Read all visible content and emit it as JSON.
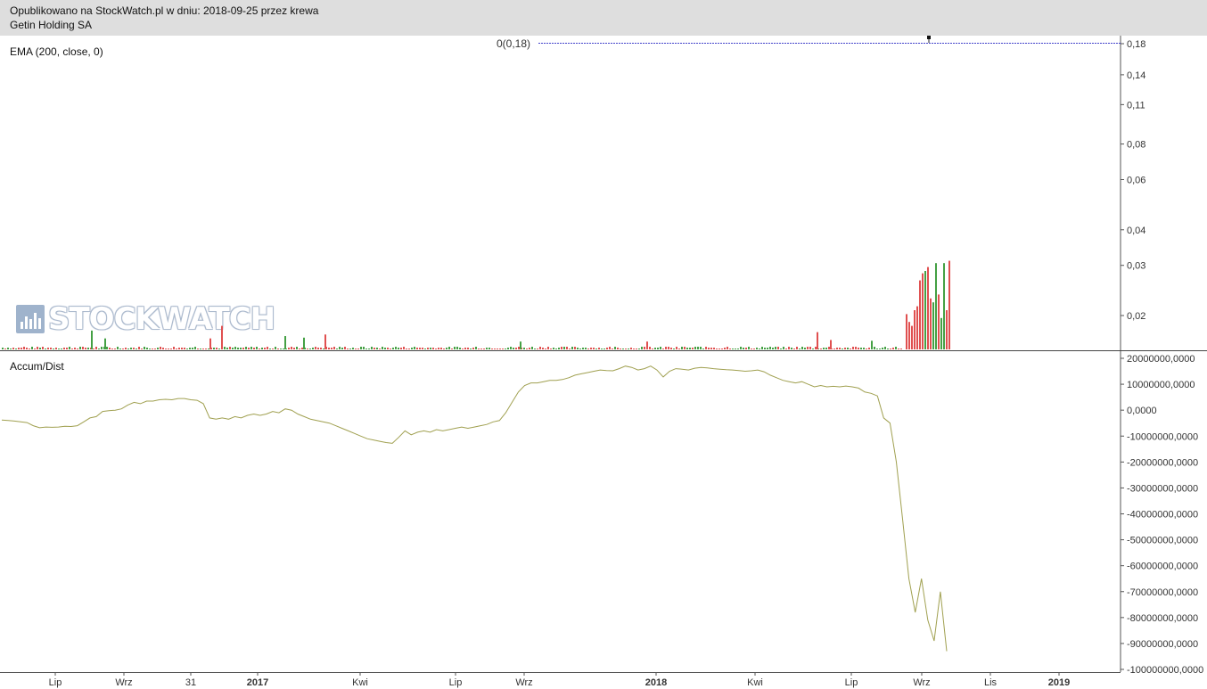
{
  "header": {
    "published": "Opublikowano na StockWatch.pl w dniu: 2018-09-25 przez krewa",
    "instrument": "Getin Holding SA"
  },
  "watermark": {
    "text": "STOCKWATCH",
    "icon": "bar-chart-logo-icon"
  },
  "price_panel": {
    "label": "EMA (200, close, 0)",
    "ema_marker_label": "0(0,18)",
    "ema_line_color": "#4444cc",
    "volume_up_color": "#44a044",
    "volume_down_color": "#e05050"
  },
  "accum_panel": {
    "label": "Accum/Dist",
    "line_color": "#a0a050"
  },
  "chart_data": [
    {
      "type": "bar",
      "title": "EMA (200, close, 0)",
      "scale": "log",
      "y_ticks": [
        "0,18",
        "0,14",
        "0,11",
        "0,08",
        "0,06",
        "0,04",
        "0,03",
        "0,02"
      ],
      "y_tick_values": [
        0.18,
        0.14,
        0.11,
        0.08,
        0.06,
        0.04,
        0.03,
        0.02
      ],
      "ylim": [
        0.0155,
        0.185
      ],
      "ema_value": 0.18,
      "volume_bars": [
        {
          "x": 102,
          "v": 0.24,
          "up": true
        },
        {
          "x": 117,
          "v": 0.14,
          "up": true
        },
        {
          "x": 248,
          "v": 0.3,
          "up": false
        },
        {
          "x": 235,
          "v": 0.14,
          "up": false
        },
        {
          "x": 319,
          "v": 0.17,
          "up": true
        },
        {
          "x": 340,
          "v": 0.15,
          "up": true
        },
        {
          "x": 364,
          "v": 0.19,
          "up": false
        },
        {
          "x": 583,
          "v": 0.1,
          "up": true
        },
        {
          "x": 725,
          "v": 0.1,
          "up": false
        },
        {
          "x": 916,
          "v": 0.22,
          "up": false
        },
        {
          "x": 931,
          "v": 0.12,
          "up": false
        },
        {
          "x": 977,
          "v": 0.11,
          "up": true
        },
        {
          "x": 1016,
          "v": 0.45,
          "up": false
        },
        {
          "x": 1019,
          "v": 0.35,
          "up": false
        },
        {
          "x": 1022,
          "v": 0.3,
          "up": false
        },
        {
          "x": 1025,
          "v": 0.5,
          "up": false
        },
        {
          "x": 1028,
          "v": 0.55,
          "up": false
        },
        {
          "x": 1031,
          "v": 0.88,
          "up": false
        },
        {
          "x": 1034,
          "v": 0.97,
          "up": false
        },
        {
          "x": 1037,
          "v": 1.0,
          "up": true
        },
        {
          "x": 1040,
          "v": 1.05,
          "up": false
        },
        {
          "x": 1043,
          "v": 0.65,
          "up": false
        },
        {
          "x": 1046,
          "v": 0.6,
          "up": true
        },
        {
          "x": 1049,
          "v": 1.1,
          "up": true
        },
        {
          "x": 1052,
          "v": 0.7,
          "up": false
        },
        {
          "x": 1055,
          "v": 0.4,
          "up": true
        },
        {
          "x": 1058,
          "v": 1.1,
          "up": true
        },
        {
          "x": 1061,
          "v": 0.5,
          "up": false
        },
        {
          "x": 1064,
          "v": 1.13,
          "up": false
        }
      ]
    },
    {
      "type": "line",
      "title": "Accum/Dist",
      "y_ticks": [
        "20000000,0000",
        "10000000,0000",
        "0,0000",
        "-10000000,0000",
        "-20000000,0000",
        "-30000000,0000",
        "-40000000,0000",
        "-50000000,0000",
        "-60000000,0000",
        "-70000000,0000",
        "-80000000,0000",
        "-90000000,0000",
        "-100000000,0000"
      ],
      "y_tick_values": [
        20000000,
        10000000,
        0,
        -10000000,
        -20000000,
        -30000000,
        -40000000,
        -50000000,
        -60000000,
        -70000000,
        -80000000,
        -90000000,
        -100000000
      ],
      "ylim": [
        -100000000,
        22000000
      ],
      "x_ticks": [
        {
          "label": "Lip",
          "bold": false
        },
        {
          "label": "Wrz",
          "bold": false
        },
        {
          "label": "31",
          "bold": false
        },
        {
          "label": "2017",
          "bold": true
        },
        {
          "label": "Kwi",
          "bold": false
        },
        {
          "label": "Lip",
          "bold": false
        },
        {
          "label": "Wrz",
          "bold": false
        },
        {
          "label": "2018",
          "bold": true
        },
        {
          "label": "Kwi",
          "bold": false
        },
        {
          "label": "Lip",
          "bold": false
        },
        {
          "label": "Wrz",
          "bold": false
        },
        {
          "label": "Lis",
          "bold": false
        },
        {
          "label": "2019",
          "bold": true
        }
      ],
      "series": [
        {
          "values": [
            -3800000,
            -4000000,
            -4200000,
            -4500000,
            -4800000,
            -6000000,
            -6800000,
            -6500000,
            -6600000,
            -6500000,
            -6200000,
            -6300000,
            -6000000,
            -4500000,
            -3000000,
            -2500000,
            -500000,
            -200000,
            0,
            500000,
            2000000,
            3000000,
            2500000,
            3500000,
            3500000,
            4000000,
            4200000,
            4000000,
            4500000,
            4500000,
            4000000,
            3800000,
            2500000,
            -3000000,
            -3500000,
            -3000000,
            -3500000,
            -2500000,
            -3000000,
            -2000000,
            -1500000,
            -2000000,
            -1500000,
            -500000,
            -1000000,
            500000,
            0,
            -1500000,
            -2500000,
            -3500000,
            -4000000,
            -4500000,
            -5000000,
            -6000000,
            -7000000,
            -8000000,
            -9000000,
            -10000000,
            -11000000,
            -11500000,
            -12000000,
            -12500000,
            -12800000,
            -10500000,
            -8000000,
            -9500000,
            -8500000,
            -8000000,
            -8500000,
            -7500000,
            -8000000,
            -7500000,
            -7000000,
            -6500000,
            -7000000,
            -6500000,
            -6000000,
            -5500000,
            -4500000,
            -4000000,
            -1000000,
            3000000,
            7000000,
            9500000,
            10500000,
            10500000,
            11000000,
            11500000,
            11500000,
            11800000,
            12500000,
            13500000,
            14000000,
            14500000,
            15000000,
            15500000,
            15300000,
            15200000,
            16000000,
            17000000,
            16500000,
            15500000,
            16000000,
            17000000,
            15500000,
            12800000,
            15000000,
            16000000,
            15800000,
            15500000,
            16200000,
            16500000,
            16300000,
            16000000,
            15800000,
            15600000,
            15500000,
            15300000,
            15000000,
            15200000,
            15500000,
            14800000,
            13500000,
            12500000,
            11500000,
            11000000,
            10500000,
            11000000,
            10000000,
            9000000,
            9500000,
            9000000,
            9200000,
            9000000,
            9300000,
            9000000,
            8500000,
            7000000,
            6500000,
            5500000,
            -3000000,
            -5000000,
            -20000000,
            -42000000,
            -65000000,
            -78000000,
            -65000000,
            -81000000,
            -89000000,
            -70000000,
            -93000000
          ]
        }
      ]
    }
  ]
}
